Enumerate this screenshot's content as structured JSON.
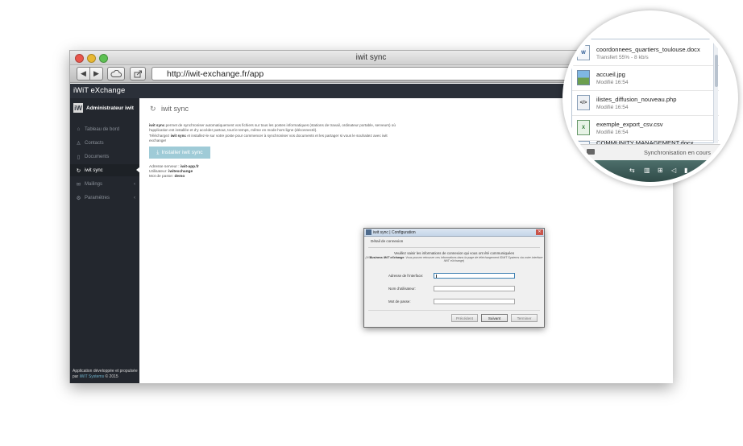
{
  "window": {
    "title": "iwit sync",
    "url": "http://iwit-exchange.fr/app"
  },
  "app": {
    "title": "iWiT eXchange",
    "user": "Administrateur iwit",
    "avatar": "iW"
  },
  "sidebar": {
    "items": [
      {
        "label": "Tableau de bord",
        "icon": "dashboard-icon",
        "glyph": "⌂"
      },
      {
        "label": "Contacts",
        "icon": "user-icon",
        "glyph": "♙"
      },
      {
        "label": "Documents",
        "icon": "document-icon",
        "glyph": "▯"
      },
      {
        "label": "iwit sync",
        "icon": "sync-icon",
        "glyph": "↻",
        "active": true
      },
      {
        "label": "Mailings",
        "icon": "mail-icon",
        "glyph": "✉",
        "chevron": "‹"
      },
      {
        "label": "Paramètres",
        "icon": "gear-icon",
        "glyph": "⚙",
        "chevron": "‹"
      }
    ],
    "footer_text": "Application développée et propulsée par",
    "footer_link": "iWiT Systems",
    "footer_year": "© 2015"
  },
  "page": {
    "title": "iwit sync",
    "desc_product": "iwit sync",
    "desc_line1": " permet de synchroniser automatiquement vos fichiers sur tous les postes informatiques (stations de travail, ordinateur portable, serveurs) où l'application est installée et d'y accéder partout, tout le temps, même en mode hors ligne (déconnecté).",
    "desc_line2a": "Téléchargez ",
    "desc_product2": "iwit sync",
    "desc_line2b": " et installez-le sur votre poste pour commencer à synchroniser vos documents et les partager si vous le souhaitez avec iwit exchange!",
    "install_button": "Installer iwit sync",
    "server_label": "Adresse serveur : ",
    "server_value": "iwit-app.fr",
    "user_label": "Utilisateur: ",
    "user_value": "iwitexchange",
    "password_label": "Mot de passe: ",
    "password_value": "demo"
  },
  "dialog": {
    "title": "iwit sync | Configuration",
    "section": "Détail de connexion",
    "message": "Veuillez saisir les informations de connexion qui vous ont été communiquées",
    "sub_prefix": "(V/l",
    "sub_bold": "Business iWiT eXchange",
    "sub_rest": ". Vous pouvez retrouver ces informations dans la page de téléchargement iSWiT Systems via votre interface iWiT eXchange)",
    "fields": [
      {
        "label": "Adresse de l'interface:",
        "value": ""
      },
      {
        "label": "Nom d'utilisateur:",
        "value": ""
      },
      {
        "label": "Mot de passe:",
        "value": ""
      }
    ],
    "buttons": {
      "prev": "Précédent",
      "next": "Suivant",
      "finish": "Terminer"
    }
  },
  "magnifier": {
    "files": [
      {
        "name": "coordonnees_quartiers_toulouse.docx",
        "status": "Transfert  55% - 8 kb/s",
        "type": "docx",
        "badge": "W"
      },
      {
        "name": "accueil.jpg",
        "status": "Modifié 16:54",
        "type": "img",
        "badge": ""
      },
      {
        "name": "ilistes_diffusion_nouveau.php",
        "status": "Modifié 16:54",
        "type": "php",
        "badge": "</>"
      },
      {
        "name": "exemple_export_csv.csv",
        "status": "Modifié 16:54",
        "type": "csv",
        "badge": "X"
      },
      {
        "name": "COMMUNITY MANAGEMENT.docx",
        "status": "",
        "type": "docx",
        "badge": "W"
      }
    ],
    "status_text": "Synchronisation en cours"
  },
  "colors": {
    "sidebar_bg": "#23272e",
    "header_bg": "#2b3039",
    "install_button": "#9fcbd7",
    "taskbar": "#3d5c58"
  }
}
